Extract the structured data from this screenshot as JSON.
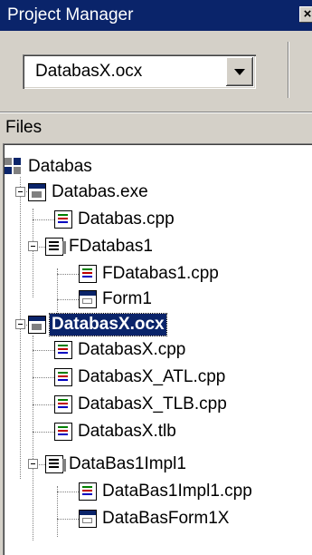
{
  "window": {
    "title": "Project Manager",
    "close_glyph": "×"
  },
  "toolbar": {
    "project_combo_value": "DatabasX.ocx"
  },
  "files_panel": {
    "header": "Files"
  },
  "tree": {
    "root": {
      "label": "Databas",
      "icon": "project-group-icon"
    },
    "items": [
      {
        "label": "Databas.exe",
        "icon": "exe-project-icon",
        "expanded": true
      },
      {
        "label": "Databas.cpp",
        "icon": "cpp-file-icon"
      },
      {
        "label": "FDatabas1",
        "icon": "unit-icon",
        "expanded": true
      },
      {
        "label": "FDatabas1.cpp",
        "icon": "cpp-file-icon"
      },
      {
        "label": "Form1",
        "icon": "form-icon"
      },
      {
        "label": "DatabasX.ocx",
        "icon": "exe-project-icon",
        "expanded": true,
        "selected": true
      },
      {
        "label": "DatabasX.cpp",
        "icon": "cpp-file-icon"
      },
      {
        "label": "DatabasX_ATL.cpp",
        "icon": "cpp-file-icon"
      },
      {
        "label": "DatabasX_TLB.cpp",
        "icon": "cpp-file-icon"
      },
      {
        "label": "DatabasX.tlb",
        "icon": "cpp-file-icon"
      },
      {
        "label": "DataBas1Impl1",
        "icon": "unit-icon",
        "expanded": true
      },
      {
        "label": "DataBas1Impl1.cpp",
        "icon": "cpp-file-icon"
      },
      {
        "label": "DataBasForm1X",
        "icon": "form-icon"
      }
    ]
  },
  "colors": {
    "titlebar": "#0a246a",
    "face": "#d4d0c8",
    "selection": "#0a246a"
  }
}
